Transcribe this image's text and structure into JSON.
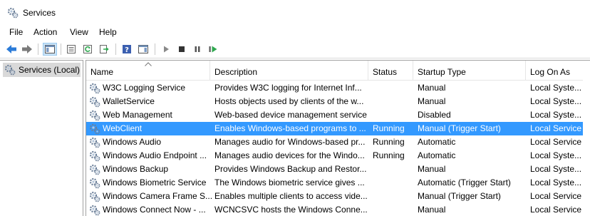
{
  "window": {
    "title": "Services",
    "icon": "services-gear-icon"
  },
  "menu": [
    "File",
    "Action",
    "View",
    "Help"
  ],
  "toolbar": {
    "buttons": [
      "back-icon",
      "forward-icon",
      "show-hide-console-tree-icon",
      "properties-icon",
      "refresh-icon",
      "export-list-icon",
      "help-icon",
      "show-hide-action-pane-icon",
      "start-service-icon",
      "stop-service-icon",
      "pause-service-icon",
      "restart-service-icon"
    ]
  },
  "tree": {
    "root_label": "Services (Local)"
  },
  "columns": {
    "name": "Name",
    "description": "Description",
    "status": "Status",
    "startup": "Startup Type",
    "logon": "Log On As"
  },
  "colors": {
    "selection": "#3399ff",
    "tree_selected": "#d9d9d9",
    "back_arrow": "#2b7bd8",
    "play_green": "#2fa84f"
  },
  "rows": [
    {
      "name": "W3C Logging Service",
      "description": "Provides W3C logging for Internet Inf...",
      "status": "",
      "startup": "Manual",
      "logon": "Local Syste..."
    },
    {
      "name": "WalletService",
      "description": "Hosts objects used by clients of the w...",
      "status": "",
      "startup": "Manual",
      "logon": "Local Syste..."
    },
    {
      "name": "Web Management",
      "description": "Web-based device management service",
      "status": "",
      "startup": "Disabled",
      "logon": "Local Syste..."
    },
    {
      "name": "WebClient",
      "description": "Enables Windows-based programs to ...",
      "status": "Running",
      "startup": "Manual (Trigger Start)",
      "logon": "Local Service",
      "selected": true
    },
    {
      "name": "Windows Audio",
      "description": "Manages audio for Windows-based pr...",
      "status": "Running",
      "startup": "Automatic",
      "logon": "Local Service"
    },
    {
      "name": "Windows Audio Endpoint ...",
      "description": "Manages audio devices for the Windo...",
      "status": "Running",
      "startup": "Automatic",
      "logon": "Local Syste..."
    },
    {
      "name": "Windows Backup",
      "description": "Provides Windows Backup and Restor...",
      "status": "",
      "startup": "Manual",
      "logon": "Local Syste..."
    },
    {
      "name": "Windows Biometric Service",
      "description": "The Windows biometric service gives ...",
      "status": "",
      "startup": "Automatic (Trigger Start)",
      "logon": "Local Syste..."
    },
    {
      "name": "Windows Camera Frame S...",
      "description": "Enables multiple clients to access vide...",
      "status": "",
      "startup": "Manual (Trigger Start)",
      "logon": "Local Service"
    },
    {
      "name": "Windows Connect Now - ...",
      "description": "WCNCSVC hosts the Windows Conne...",
      "status": "",
      "startup": "Manual",
      "logon": "Local Service"
    }
  ]
}
